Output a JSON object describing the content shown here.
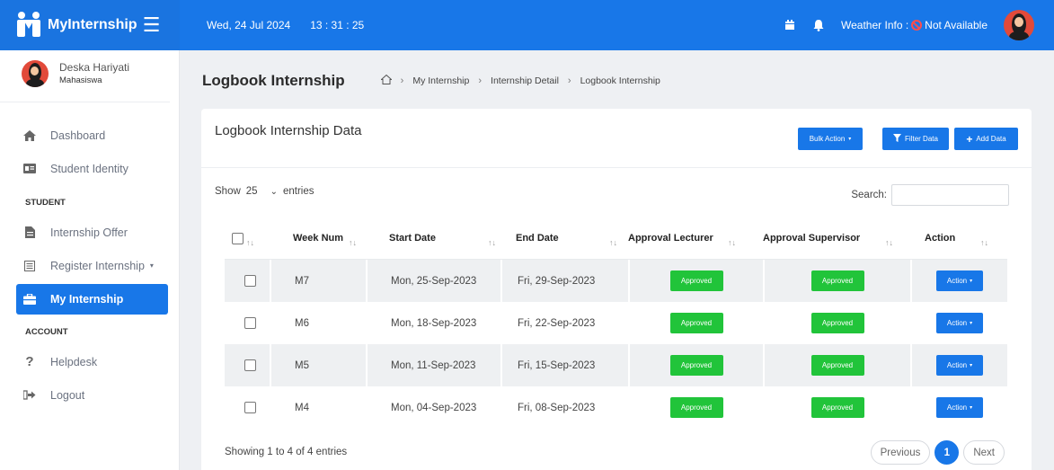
{
  "app": {
    "name": "MyInternship"
  },
  "topbar": {
    "date": "Wed, 24 Jul 2024",
    "time": "13 : 31 : 25",
    "weather_label": "Weather Info :",
    "weather_value": "Not Available"
  },
  "user": {
    "name": "Deska Hariyati",
    "role": "Mahasiswa"
  },
  "sidebar": {
    "items": [
      {
        "label": "Dashboard",
        "icon": "home-icon"
      },
      {
        "label": "Student Identity",
        "icon": "id-card-icon"
      }
    ],
    "section_student": "STUDENT",
    "student_items": [
      {
        "label": "Internship Offer",
        "icon": "document-icon"
      },
      {
        "label": "Register Internship",
        "icon": "form-icon"
      },
      {
        "label": "My Internship",
        "icon": "briefcase-icon",
        "active": true
      }
    ],
    "section_account": "ACCOUNT",
    "account_items": [
      {
        "label": "Helpdesk",
        "icon": "question-icon"
      },
      {
        "label": "Logout",
        "icon": "logout-icon"
      }
    ]
  },
  "page": {
    "title": "Logbook Internship",
    "breadcrumb": [
      "My Internship",
      "Internship Detail",
      "Logbook Internship"
    ]
  },
  "card": {
    "title": "Logbook Internship Data",
    "bulk_action": "Bulk Action",
    "filter_data": "Filter Data",
    "add_data": "Add Data"
  },
  "controls": {
    "show": "Show",
    "entries_value": "25",
    "entries": "entries",
    "search": "Search:"
  },
  "table": {
    "columns": [
      "Week Num",
      "Start Date",
      "End Date",
      "Approval Lecturer",
      "Approval Supervisor",
      "Action"
    ],
    "rows": [
      {
        "week": "M7",
        "start": "Mon, 25-Sep-2023",
        "end": "Fri, 29-Sep-2023",
        "lecturer": "Approved",
        "supervisor": "Approved",
        "action": "Action"
      },
      {
        "week": "M6",
        "start": "Mon, 18-Sep-2023",
        "end": "Fri, 22-Sep-2023",
        "lecturer": "Approved",
        "supervisor": "Approved",
        "action": "Action"
      },
      {
        "week": "M5",
        "start": "Mon, 11-Sep-2023",
        "end": "Fri, 15-Sep-2023",
        "lecturer": "Approved",
        "supervisor": "Approved",
        "action": "Action"
      },
      {
        "week": "M4",
        "start": "Mon, 04-Sep-2023",
        "end": "Fri, 08-Sep-2023",
        "lecturer": "Approved",
        "supervisor": "Approved",
        "action": "Action"
      }
    ]
  },
  "footer": {
    "info": "Showing 1 to 4 of 4 entries",
    "previous": "Previous",
    "page": "1",
    "next": "Next"
  },
  "colors": {
    "primary": "#1877e8",
    "success": "#21c43a"
  }
}
